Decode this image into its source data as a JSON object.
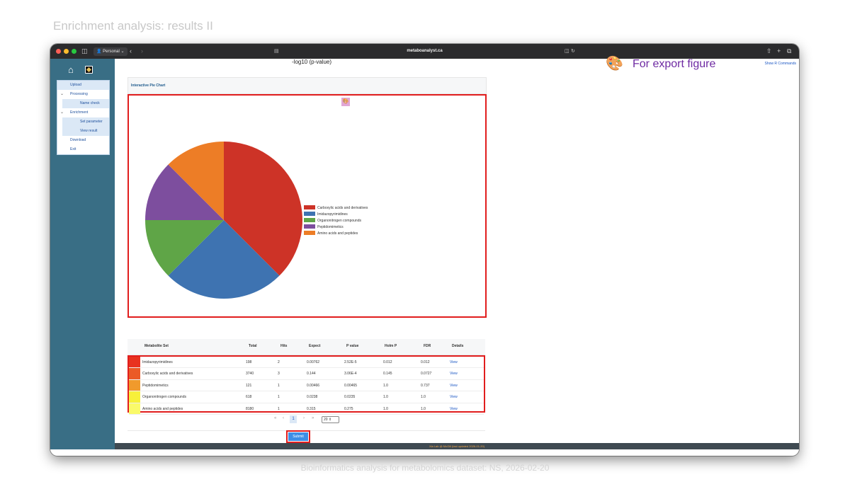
{
  "slide": {
    "title": "Enrichment analysis: results II",
    "footer": "Bioinformatics analysis for metabolomics dataset: NS, 2026-02-20"
  },
  "browser": {
    "profile": "Personal",
    "url": "metaboanalyst.ca"
  },
  "sidebar": {
    "items": [
      {
        "label": "Upload",
        "level": "top",
        "highlighted": true
      },
      {
        "label": "Processing",
        "level": "top",
        "expandable": true
      },
      {
        "label": "Name check",
        "level": "sub"
      },
      {
        "label": "Enrichment",
        "level": "top",
        "expandable": true
      },
      {
        "label": "Set parameter",
        "level": "sub"
      },
      {
        "label": "View result",
        "level": "sub"
      },
      {
        "label": "Download",
        "level": "top"
      },
      {
        "label": "Exit",
        "level": "top"
      }
    ]
  },
  "content": {
    "log_title": "-log10 (p-value)",
    "show_r_commands": "Show R Commands",
    "pie_header": "Interactive Pie Chart",
    "annotation": "For export figure",
    "submit_label": "Submit",
    "status_text": "Xia Lab @ McGill   (last updated 2026-01-20)"
  },
  "chart_data": {
    "type": "pie",
    "series": [
      {
        "name": "Carboxylic acids and derivatives",
        "value": 3,
        "color": "#cd3327"
      },
      {
        "name": "Imidazopyrimidines",
        "value": 2,
        "color": "#3e73b1"
      },
      {
        "name": "Organonitrogen compounds",
        "value": 1,
        "color": "#5fa547"
      },
      {
        "name": "Peptidomimetics",
        "value": 1,
        "color": "#7d4e9e"
      },
      {
        "name": "Amino acids and peptides",
        "value": 1,
        "color": "#ed7d26"
      }
    ],
    "legend_position": "right"
  },
  "table": {
    "columns": [
      "Metabolite Set",
      "Total",
      "Hits",
      "Expect",
      "P value",
      "Holm P",
      "FDR",
      "Details"
    ],
    "rows": [
      {
        "swatch": "#e8321f",
        "set": "Imidazopyrimidines",
        "total": "198",
        "hits": "2",
        "expect": "0.00762",
        "p": "2.52E-5",
        "holm": "0.012",
        "fdr": "0.012",
        "details": "View"
      },
      {
        "swatch": "#eb5a26",
        "set": "Carboxylic acids and derivatives",
        "total": "3740",
        "hits": "3",
        "expect": "0.144",
        "p": "3.06E-4",
        "holm": "0.145",
        "fdr": "0.0727",
        "details": "View"
      },
      {
        "swatch": "#f09a2c",
        "set": "Peptidomimetics",
        "total": "121",
        "hits": "1",
        "expect": "0.00466",
        "p": "0.00465",
        "holm": "1.0",
        "fdr": "0.737",
        "details": "View"
      },
      {
        "swatch": "#f7f03a",
        "set": "Organonitrogen compounds",
        "total": "618",
        "hits": "1",
        "expect": "0.0238",
        "p": "0.0235",
        "holm": "1.0",
        "fdr": "1.0",
        "details": "View"
      },
      {
        "swatch": "#fafa6a",
        "set": "Amino acids and peptides",
        "total": "8180",
        "hits": "1",
        "expect": "0.315",
        "p": "0.275",
        "holm": "1.0",
        "fdr": "1.0",
        "details": "View"
      }
    ]
  },
  "pager": {
    "current_page": "1",
    "page_size": "20"
  },
  "icons": {
    "home": "home-icon",
    "logo": "app-logo-icon",
    "palette": "palette-icon"
  }
}
